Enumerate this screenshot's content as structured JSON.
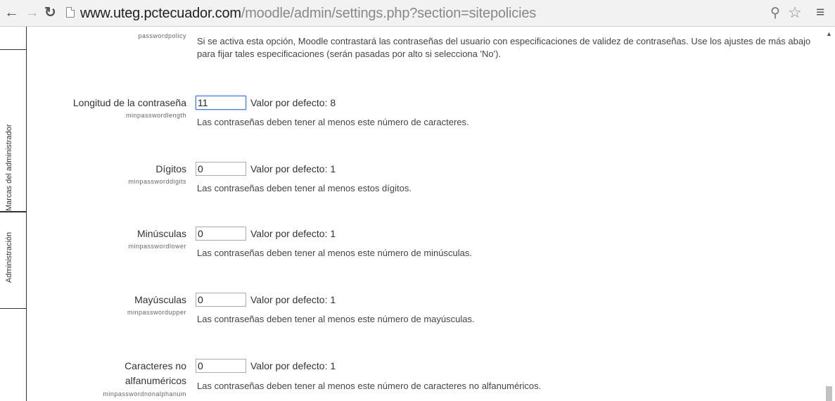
{
  "browser": {
    "url_host": "www.uteg.pctecuador.com",
    "url_path": "/moodle/admin/settings.php?section=sitepolicies"
  },
  "side_tabs": {
    "admin_bookmarks": "Marcas del administrador",
    "administration": "Administración"
  },
  "policy": {
    "key": "passwordpolicy",
    "description": "Si se activa esta opción, Moodle contrastará las contraseñas del usuario con especificaciones de validez de contraseñas. Use los ajustes de más abajo para fijar tales especificaciones (serán pasadas por alto si selecciona 'No')."
  },
  "settings": [
    {
      "label": "Longitud de la contraseña",
      "key": "minpasswordlength",
      "value": "11",
      "default": "Valor por defecto: 8",
      "description": "Las contraseñas deben tener al menos este número de caracteres."
    },
    {
      "label": "Dígitos",
      "key": "minpassworddigits",
      "value": "0",
      "default": "Valor por defecto: 1",
      "description": "Las contraseñas deben tener al menos estos dígitos."
    },
    {
      "label": "Minúsculas",
      "key": "minpasswordlower",
      "value": "0",
      "default": "Valor por defecto: 1",
      "description": "Las contraseñas deben tener al menos este número de minúsculas."
    },
    {
      "label": "Mayúsculas",
      "key": "minpasswordupper",
      "value": "0",
      "default": "Valor por defecto: 1",
      "description": "Las contraseñas deben tener al menos este número de mayúsculas."
    },
    {
      "label_line1": "Caracteres no",
      "label_line2": "alfanuméricos",
      "key": "minpasswordnonalphanum",
      "value": "0",
      "default": "Valor por defecto: 1",
      "description": "Las contraseñas deben tener al menos este número de caracteres no alfanuméricos."
    }
  ],
  "colors": {
    "focus_border": "#4a7bd2",
    "toolbar_bg": "#f2f2f2"
  }
}
